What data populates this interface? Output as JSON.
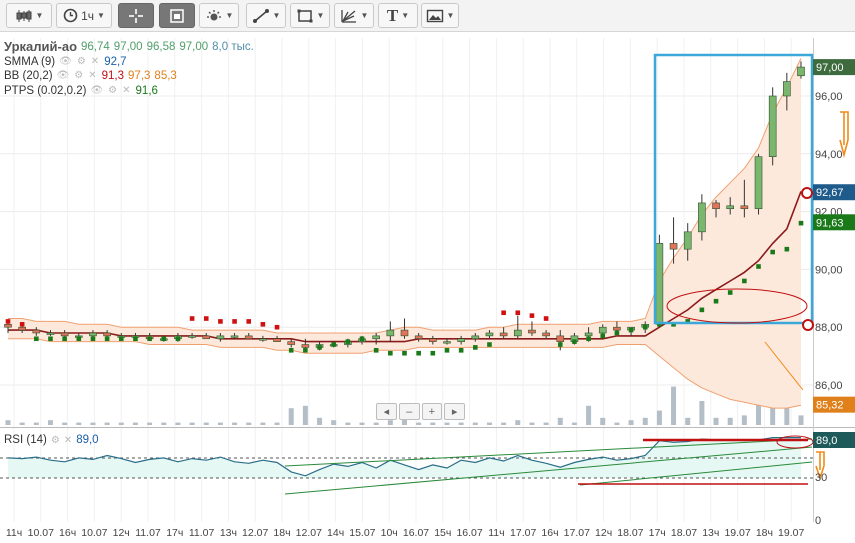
{
  "toolbar": {
    "chart_type_icon": "candlestick-icon",
    "interval": "1ч",
    "crosshair_icon": "crosshair-icon",
    "fullscreen_icon": "frame-icon",
    "indicators_icon": "indicators-icon",
    "draw_line_icon": "line-draw-icon",
    "shapes_icon": "rectangle-icon",
    "fib_icon": "fibonacci-icon",
    "text_tool": "T",
    "image_icon": "image-icon"
  },
  "legend": {
    "instrument": "Уркалий-ао",
    "ohlc": [
      "96,74",
      "97,00",
      "96,58",
      "97,00"
    ],
    "volume": "8,0 тыс.",
    "smma_label": "SMMA (9)",
    "smma_value": "92,7",
    "bb_label": "BB (20,2)",
    "bb_values": [
      "91,3",
      "97,3",
      "85,3"
    ],
    "ptps_label": "PTPS (0.02,0.2)",
    "ptps_value": "91,6"
  },
  "rsi_legend": {
    "label": "RSI (14)",
    "value": "89,0"
  },
  "zoom_controls": [
    "◂",
    "–",
    "+",
    "▸"
  ],
  "colors": {
    "up_candle": "#7bb66f",
    "down_candle": "#e0735a",
    "bb_band": "#f0a070",
    "bb_fill": "#fde9dc",
    "smma": "#8b1a1a",
    "ptps_up": "#1a7a1a",
    "ptps_down": "#d01010",
    "volume": "#b3bec7",
    "rsi_line": "#2a6d8a",
    "rsi_fill": "#e6f8f3",
    "trend_green": "#2a8a3a",
    "annotation_blue": "#3aa8d8",
    "annotation_red": "#c01010",
    "annotation_orange": "#f08a1a"
  },
  "chart_data": [
    {
      "type": "candlestick",
      "title": "Уркалий-ао",
      "y_axis_labels": [
        "96,00",
        "94,00",
        "92,00",
        "90,00",
        "88,00",
        "86,00"
      ],
      "ylim": [
        84.5,
        98.4
      ],
      "x_tick_labels": [
        "11ч",
        "10.07",
        "16ч",
        "10.07",
        "12ч",
        "11.07",
        "17ч",
        "11.07",
        "13ч",
        "12.07",
        "18ч",
        "12.07",
        "14ч",
        "15.07",
        "10ч",
        "16.07",
        "15ч",
        "16.07",
        "11ч",
        "17.07",
        "16ч",
        "17.07",
        "12ч",
        "18.07",
        "17ч",
        "18.07",
        "13ч",
        "19.07",
        "18ч",
        "19.07"
      ],
      "price_tags": [
        {
          "label": "97,00",
          "kind": "last"
        },
        {
          "label": "92,67",
          "kind": "smma"
        },
        {
          "label": "91,63",
          "kind": "ptps"
        },
        {
          "label": "85,32",
          "kind": "bb_lower"
        }
      ],
      "candles": [
        [
          88.1,
          88.2,
          87.8,
          88.0
        ],
        [
          88.0,
          88.1,
          87.8,
          87.9
        ],
        [
          87.9,
          88.0,
          87.7,
          87.8
        ],
        [
          87.8,
          87.9,
          87.7,
          87.8
        ],
        [
          87.8,
          87.9,
          87.6,
          87.7
        ],
        [
          87.7,
          87.8,
          87.6,
          87.7
        ],
        [
          87.7,
          87.9,
          87.6,
          87.8
        ],
        [
          87.8,
          87.9,
          87.6,
          87.7
        ],
        [
          87.7,
          87.8,
          87.6,
          87.7
        ],
        [
          87.7,
          87.8,
          87.6,
          87.7
        ],
        [
          87.7,
          87.8,
          87.6,
          87.6
        ],
        [
          87.6,
          87.7,
          87.5,
          87.6
        ],
        [
          87.6,
          87.8,
          87.5,
          87.7
        ],
        [
          87.7,
          87.8,
          87.6,
          87.7
        ],
        [
          87.7,
          87.8,
          87.6,
          87.6
        ],
        [
          87.6,
          87.8,
          87.5,
          87.7
        ],
        [
          87.7,
          87.8,
          87.6,
          87.7
        ],
        [
          87.7,
          87.8,
          87.6,
          87.6
        ],
        [
          87.6,
          87.7,
          87.5,
          87.6
        ],
        [
          87.6,
          87.7,
          87.5,
          87.5
        ],
        [
          87.5,
          87.6,
          87.3,
          87.4
        ],
        [
          87.4,
          87.6,
          87.2,
          87.3
        ],
        [
          87.3,
          87.5,
          87.2,
          87.4
        ],
        [
          87.4,
          87.5,
          87.3,
          87.4
        ],
        [
          87.4,
          87.6,
          87.3,
          87.5
        ],
        [
          87.5,
          87.7,
          87.4,
          87.6
        ],
        [
          87.6,
          87.8,
          87.4,
          87.7
        ],
        [
          87.7,
          88.2,
          87.5,
          87.9
        ],
        [
          87.9,
          88.3,
          87.6,
          87.7
        ],
        [
          87.7,
          87.8,
          87.5,
          87.6
        ],
        [
          87.6,
          87.7,
          87.4,
          87.5
        ],
        [
          87.5,
          87.6,
          87.4,
          87.5
        ],
        [
          87.5,
          87.7,
          87.4,
          87.6
        ],
        [
          87.6,
          87.8,
          87.5,
          87.7
        ],
        [
          87.7,
          87.9,
          87.6,
          87.8
        ],
        [
          87.8,
          88.0,
          87.6,
          87.7
        ],
        [
          87.7,
          88.4,
          87.6,
          87.9
        ],
        [
          87.9,
          88.2,
          87.7,
          87.8
        ],
        [
          87.8,
          87.9,
          87.6,
          87.7
        ],
        [
          87.7,
          87.9,
          87.2,
          87.5
        ],
        [
          87.5,
          87.8,
          87.4,
          87.7
        ],
        [
          87.7,
          88.0,
          87.5,
          87.8
        ],
        [
          87.8,
          88.1,
          87.6,
          88.0
        ],
        [
          88.0,
          88.2,
          87.8,
          87.9
        ],
        [
          87.9,
          88.0,
          87.7,
          88.0
        ],
        [
          88.0,
          88.2,
          87.8,
          88.1
        ],
        [
          88.1,
          91.2,
          88.0,
          90.9
        ],
        [
          90.9,
          91.8,
          90.2,
          90.7
        ],
        [
          90.7,
          91.6,
          90.3,
          91.3
        ],
        [
          91.3,
          92.6,
          91.0,
          92.3
        ],
        [
          92.3,
          92.4,
          91.8,
          92.1
        ],
        [
          92.1,
          92.5,
          91.9,
          92.2
        ],
        [
          92.2,
          93.1,
          91.8,
          92.1
        ],
        [
          92.1,
          94.0,
          91.9,
          93.9
        ],
        [
          93.9,
          96.3,
          93.6,
          96.0
        ],
        [
          96.0,
          96.8,
          95.5,
          96.5
        ],
        [
          96.7,
          97.2,
          96.6,
          97.0
        ]
      ],
      "volumes": [
        0.2,
        0.1,
        0.1,
        0.2,
        0.1,
        0.1,
        0.1,
        0.1,
        0.1,
        0.1,
        0.1,
        0.1,
        0.1,
        0.1,
        0.1,
        0.1,
        0.1,
        0.1,
        0.1,
        0.1,
        0.7,
        0.8,
        0.3,
        0.2,
        0.1,
        0.1,
        0.1,
        0.2,
        0.3,
        0.1,
        0.1,
        0.1,
        0.1,
        0.1,
        0.1,
        0.1,
        0.2,
        0.1,
        0.1,
        0.3,
        0.1,
        0.8,
        0.3,
        0.1,
        0.2,
        0.3,
        0.6,
        1.6,
        0.3,
        1.0,
        0.3,
        0.3,
        0.4,
        1.5,
        2.4,
        1.3,
        0.4
      ],
      "smma": [
        87.9,
        87.9,
        87.9,
        87.8,
        87.8,
        87.8,
        87.8,
        87.8,
        87.7,
        87.7,
        87.7,
        87.7,
        87.7,
        87.7,
        87.7,
        87.6,
        87.6,
        87.6,
        87.6,
        87.6,
        87.6,
        87.5,
        87.5,
        87.5,
        87.5,
        87.5,
        87.5,
        87.5,
        87.5,
        87.6,
        87.6,
        87.6,
        87.6,
        87.6,
        87.6,
        87.6,
        87.6,
        87.6,
        87.6,
        87.6,
        87.6,
        87.6,
        87.6,
        87.7,
        87.7,
        87.7,
        88.0,
        88.3,
        88.6,
        89.0,
        89.3,
        89.6,
        89.9,
        90.3,
        90.9,
        91.4,
        92.7
      ],
      "bb_upper": [
        88.3,
        88.3,
        88.2,
        88.2,
        88.2,
        88.1,
        88.1,
        88.1,
        88.0,
        88.0,
        88.0,
        88.0,
        88.0,
        87.9,
        87.9,
        87.9,
        87.9,
        87.9,
        87.9,
        87.8,
        87.8,
        87.8,
        87.8,
        87.8,
        87.8,
        87.8,
        87.8,
        87.9,
        88.0,
        88.0,
        87.9,
        87.9,
        87.9,
        87.9,
        88.0,
        88.0,
        88.1,
        88.1,
        88.1,
        88.1,
        88.1,
        88.1,
        88.2,
        88.2,
        88.2,
        88.3,
        89.6,
        90.4,
        91.1,
        91.9,
        92.5,
        93.0,
        93.5,
        94.2,
        95.4,
        96.3,
        97.3
      ],
      "bb_lower": [
        87.6,
        87.6,
        87.6,
        87.5,
        87.5,
        87.5,
        87.5,
        87.5,
        87.5,
        87.5,
        87.4,
        87.4,
        87.4,
        87.4,
        87.4,
        87.3,
        87.3,
        87.3,
        87.3,
        87.2,
        87.2,
        87.1,
        87.1,
        87.1,
        87.1,
        87.1,
        87.2,
        87.2,
        87.2,
        87.3,
        87.3,
        87.3,
        87.3,
        87.3,
        87.3,
        87.3,
        87.3,
        87.3,
        87.3,
        87.3,
        87.3,
        87.3,
        87.3,
        87.4,
        87.4,
        87.4,
        87.0,
        86.6,
        86.2,
        85.9,
        85.7,
        85.5,
        85.4,
        85.3,
        85.2,
        85.2,
        85.3
      ],
      "ptps": [
        [
          0,
          88.2,
          "down"
        ],
        [
          1,
          88.1,
          "down"
        ],
        [
          2,
          87.6,
          "up"
        ],
        [
          3,
          87.6,
          "up"
        ],
        [
          4,
          87.6,
          "up"
        ],
        [
          5,
          87.6,
          "up"
        ],
        [
          6,
          87.6,
          "up"
        ],
        [
          7,
          87.6,
          "up"
        ],
        [
          8,
          87.6,
          "up"
        ],
        [
          9,
          87.6,
          "up"
        ],
        [
          10,
          87.6,
          "up"
        ],
        [
          11,
          87.6,
          "up"
        ],
        [
          12,
          87.6,
          "up"
        ],
        [
          13,
          88.3,
          "down"
        ],
        [
          14,
          88.3,
          "down"
        ],
        [
          15,
          88.2,
          "down"
        ],
        [
          16,
          88.2,
          "down"
        ],
        [
          17,
          88.2,
          "down"
        ],
        [
          18,
          88.1,
          "down"
        ],
        [
          19,
          88.0,
          "down"
        ],
        [
          20,
          87.2,
          "up"
        ],
        [
          21,
          87.2,
          "up"
        ],
        [
          22,
          87.3,
          "up"
        ],
        [
          23,
          87.4,
          "up"
        ],
        [
          24,
          87.5,
          "up"
        ],
        [
          25,
          87.6,
          "up"
        ],
        [
          26,
          87.2,
          "up"
        ],
        [
          27,
          87.1,
          "up"
        ],
        [
          28,
          87.1,
          "up"
        ],
        [
          29,
          87.1,
          "up"
        ],
        [
          30,
          87.1,
          "up"
        ],
        [
          31,
          87.2,
          "up"
        ],
        [
          32,
          87.2,
          "up"
        ],
        [
          33,
          87.3,
          "up"
        ],
        [
          34,
          87.4,
          "up"
        ],
        [
          35,
          88.5,
          "down"
        ],
        [
          36,
          88.5,
          "down"
        ],
        [
          37,
          88.4,
          "down"
        ],
        [
          38,
          88.3,
          "down"
        ],
        [
          39,
          87.4,
          "up"
        ],
        [
          40,
          87.5,
          "up"
        ],
        [
          41,
          87.6,
          "up"
        ],
        [
          42,
          87.7,
          "up"
        ],
        [
          43,
          87.8,
          "up"
        ],
        [
          44,
          87.9,
          "up"
        ],
        [
          45,
          88.0,
          "up"
        ],
        [
          46,
          88.1,
          "up"
        ],
        [
          47,
          88.1,
          "up"
        ],
        [
          48,
          88.2,
          "up"
        ],
        [
          49,
          88.6,
          "up"
        ],
        [
          50,
          88.9,
          "up"
        ],
        [
          51,
          89.2,
          "up"
        ],
        [
          52,
          89.6,
          "up"
        ],
        [
          53,
          90.1,
          "up"
        ],
        [
          54,
          90.6,
          "up"
        ],
        [
          55,
          90.7,
          "up"
        ],
        [
          56,
          91.6,
          "up"
        ]
      ]
    },
    {
      "type": "line",
      "title": "RSI (14)",
      "y_axis_labels": [
        "30",
        "0"
      ],
      "ylim": [
        0,
        100
      ],
      "values": [
        63,
        62,
        64,
        60,
        58,
        63,
        61,
        66,
        62,
        57,
        61,
        63,
        58,
        62,
        60,
        64,
        58,
        56,
        60,
        57,
        45,
        40,
        48,
        55,
        52,
        57,
        50,
        60,
        54,
        48,
        54,
        50,
        60,
        57,
        63,
        59,
        66,
        60,
        56,
        51,
        57,
        61,
        64,
        60,
        62,
        66,
        85,
        83,
        84,
        87,
        86,
        86,
        85,
        86,
        89,
        89,
        89
      ],
      "last_value_tag": "89,0"
    }
  ]
}
